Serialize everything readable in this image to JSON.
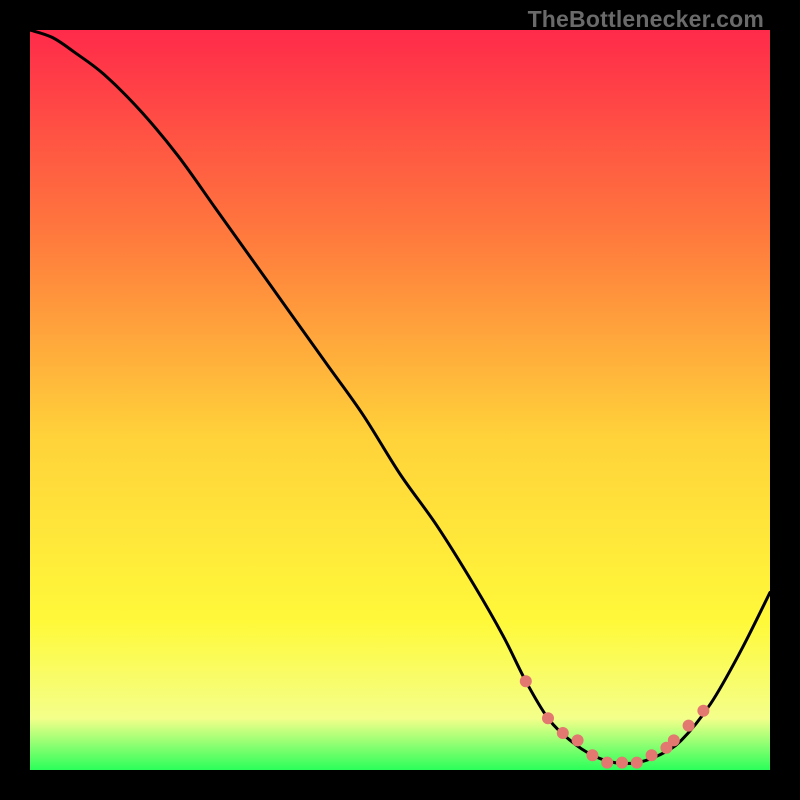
{
  "watermark": {
    "text": "TheBottlenecker.com"
  },
  "colors": {
    "bg": "#000000",
    "grad_top": "#ff2a4a",
    "grad_mid1": "#ff7a3d",
    "grad_mid2": "#ffd23a",
    "grad_mid3": "#fff93a",
    "grad_low": "#f4ff8a",
    "grad_bottom": "#2bff5a",
    "curve": "#000000",
    "dots": "#e2786f"
  },
  "chart_data": {
    "type": "line",
    "title": "",
    "xlabel": "",
    "ylabel": "",
    "xlim": [
      0,
      100
    ],
    "ylim": [
      0,
      100
    ],
    "series": [
      {
        "name": "bottleneck-curve",
        "x": [
          0,
          3,
          6,
          10,
          15,
          20,
          25,
          30,
          35,
          40,
          45,
          50,
          55,
          60,
          64,
          67,
          70,
          73,
          76,
          79,
          82,
          85,
          88,
          92,
          96,
          100
        ],
        "y": [
          100,
          99,
          97,
          94,
          89,
          83,
          76,
          69,
          62,
          55,
          48,
          40,
          33,
          25,
          18,
          12,
          7,
          4,
          2,
          1,
          1,
          2,
          4,
          9,
          16,
          24
        ]
      }
    ],
    "dots": {
      "name": "highlight-dots",
      "x": [
        67,
        70,
        72,
        74,
        76,
        78,
        80,
        82,
        84,
        86,
        87,
        89,
        91
      ],
      "y": [
        12,
        7,
        5,
        4,
        2,
        1,
        1,
        1,
        2,
        3,
        4,
        6,
        8
      ]
    },
    "gridlines": false,
    "legend": false
  }
}
